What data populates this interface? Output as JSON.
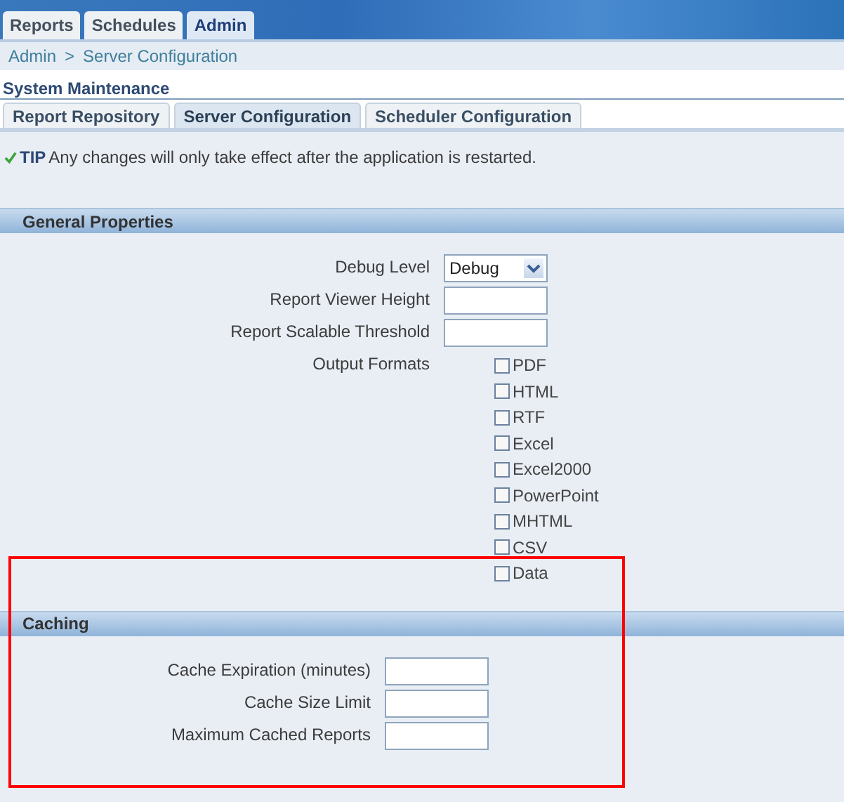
{
  "top_tabs": [
    {
      "label": "Reports",
      "selected": false
    },
    {
      "label": "Schedules",
      "selected": false
    },
    {
      "label": "Admin",
      "selected": true
    }
  ],
  "breadcrumb": {
    "items": [
      "Admin"
    ],
    "separator": ">",
    "current": "Server Configuration"
  },
  "page_title": "System Maintenance",
  "sub_tabs": [
    {
      "label": "Report Repository",
      "selected": false
    },
    {
      "label": "Server Configuration",
      "selected": true
    },
    {
      "label": "Scheduler Configuration",
      "selected": false
    }
  ],
  "tip": {
    "label": "TIP",
    "text": "Any changes will only take effect after the application is restarted."
  },
  "sections": [
    {
      "title": "General Properties",
      "fields": [
        {
          "kind": "select",
          "label": "Debug Level",
          "value": "Debug"
        },
        {
          "kind": "text",
          "label": "Report Viewer Height"
        },
        {
          "kind": "text",
          "label": "Report Scalable Threshold"
        },
        {
          "kind": "checkboxes",
          "label": "Output Formats",
          "options": [
            {
              "label": "PDF",
              "checked": false
            },
            {
              "label": "HTML",
              "checked": false
            },
            {
              "label": "RTF",
              "checked": false
            },
            {
              "label": "Excel",
              "checked": false
            },
            {
              "label": "Excel2000",
              "checked": false
            },
            {
              "label": "PowerPoint",
              "checked": false
            },
            {
              "label": "MHTML",
              "checked": false
            },
            {
              "label": "CSV",
              "checked": false
            },
            {
              "label": "Data",
              "checked": false
            }
          ]
        }
      ]
    },
    {
      "title": "Caching",
      "fields": [
        {
          "kind": "text",
          "label": "Cache Expiration (minutes)"
        },
        {
          "kind": "text",
          "label": "Cache Size Limit"
        },
        {
          "kind": "text",
          "label": "Maximum Cached Reports"
        }
      ]
    }
  ]
}
